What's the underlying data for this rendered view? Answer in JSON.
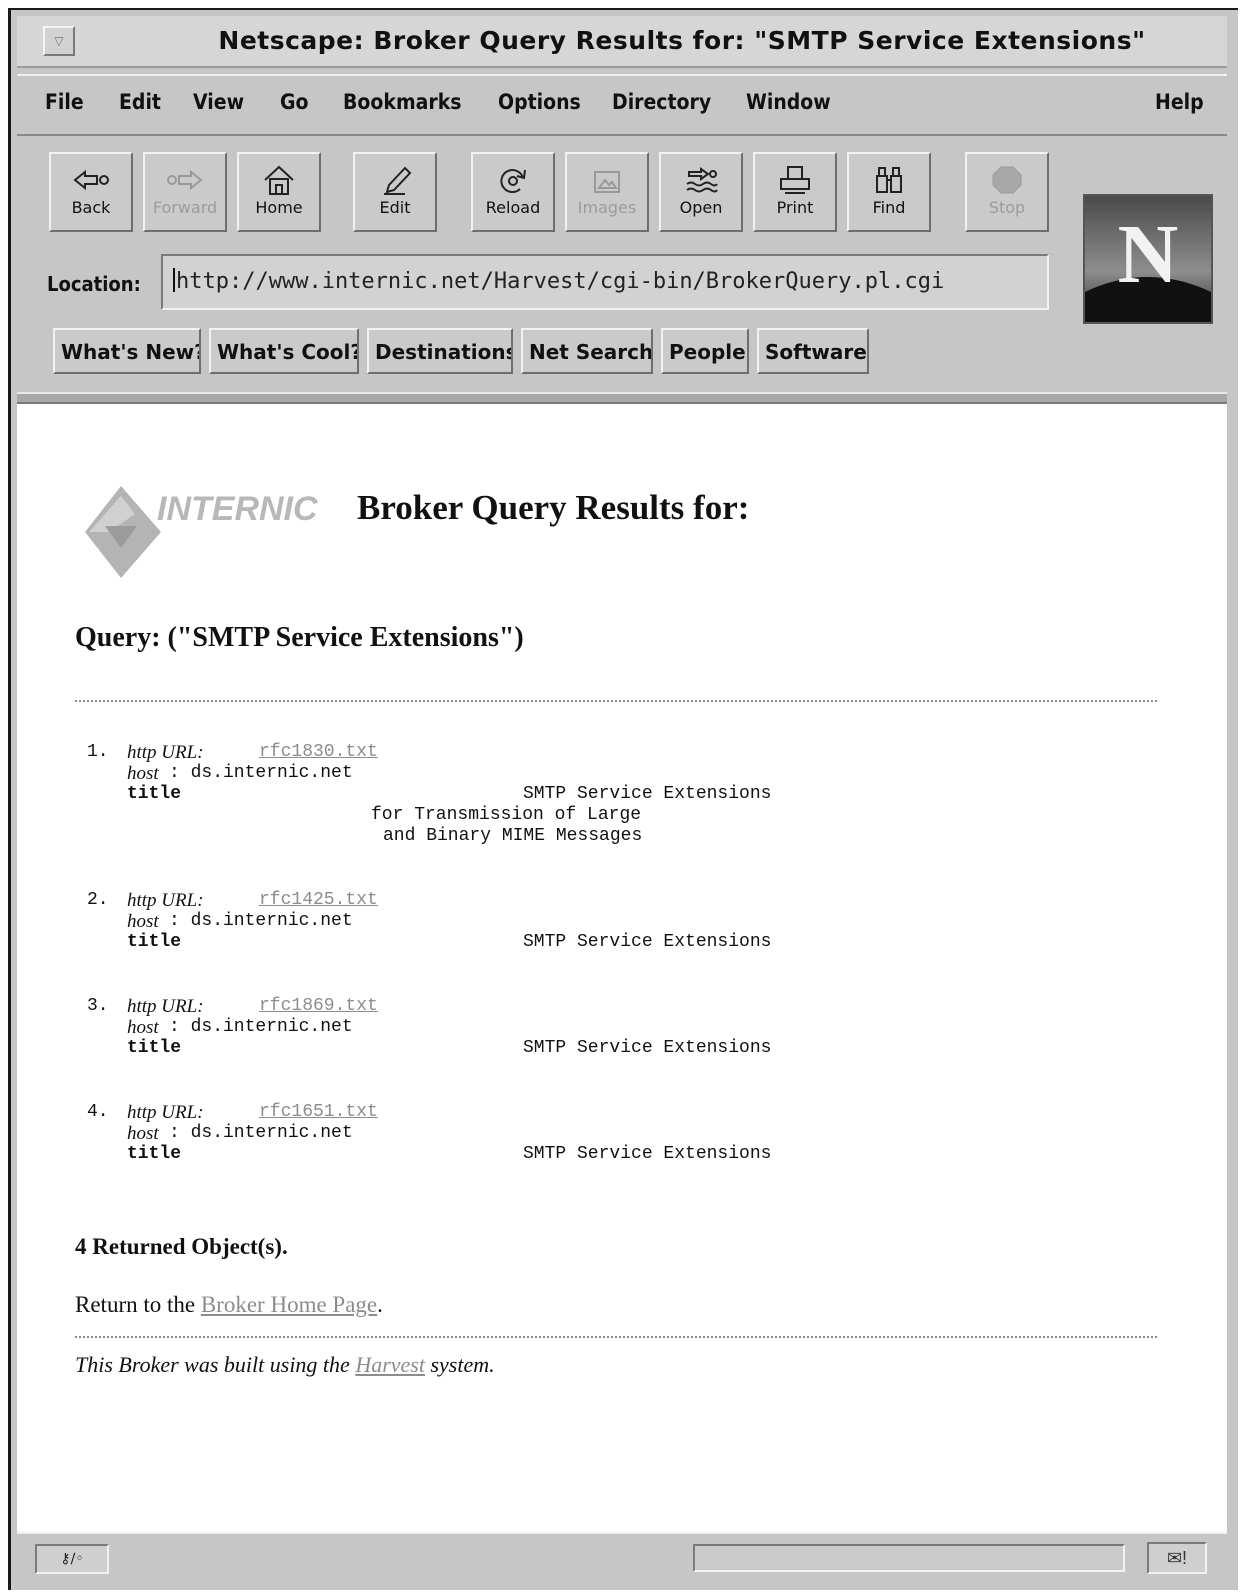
{
  "window": {
    "title": "Netscape: Broker Query Results for: \"SMTP Service Extensions\""
  },
  "menu": [
    {
      "label": "File"
    },
    {
      "label": "Edit"
    },
    {
      "label": "View"
    },
    {
      "label": "Go"
    },
    {
      "label": "Bookmarks"
    },
    {
      "label": "Options"
    },
    {
      "label": "Directory"
    },
    {
      "label": "Window"
    },
    {
      "label": "Help"
    }
  ],
  "toolbar": {
    "buttons": [
      {
        "label": "Back",
        "icon": "back-arrow-icon",
        "enabled": true
      },
      {
        "label": "Forward",
        "icon": "forward-arrow-icon",
        "enabled": false
      },
      {
        "label": "Home",
        "icon": "home-icon",
        "enabled": true
      },
      {
        "label": "Edit",
        "icon": "pencil-icon",
        "enabled": true
      },
      {
        "label": "Reload",
        "icon": "reload-icon",
        "enabled": true
      },
      {
        "label": "Images",
        "icon": "images-icon",
        "enabled": false
      },
      {
        "label": "Open",
        "icon": "open-icon",
        "enabled": true
      },
      {
        "label": "Print",
        "icon": "printer-icon",
        "enabled": true
      },
      {
        "label": "Find",
        "icon": "binoculars-icon",
        "enabled": true
      },
      {
        "label": "Stop",
        "icon": "stop-icon",
        "enabled": false
      }
    ]
  },
  "location": {
    "label": "Location:",
    "url": "http://www.internic.net/Harvest/cgi-bin/BrokerQuery.pl.cgi"
  },
  "directory_buttons": [
    {
      "label": "What's New?"
    },
    {
      "label": "What's Cool?"
    },
    {
      "label": "Destinations"
    },
    {
      "label": "Net Search"
    },
    {
      "label": "People"
    },
    {
      "label": "Software"
    }
  ],
  "page": {
    "logo_text": "INTERNIC",
    "heading": "Broker Query Results for:",
    "query": "Query: (\"SMTP Service Extensions\")",
    "results": [
      {
        "num": "1.",
        "url_label": "http URL:",
        "url": "rfc1830.txt",
        "host_label": "host",
        "host": ": ds.internic.net",
        "title_label": "title",
        "title_lines": [
          "SMTP Service Extensions",
          "for Transmission of Large",
          "and Binary MIME Messages"
        ]
      },
      {
        "num": "2.",
        "url_label": "http URL:",
        "url": "rfc1425.txt",
        "host_label": "host",
        "host": ": ds.internic.net",
        "title_label": "title",
        "title_lines": [
          "SMTP Service Extensions"
        ]
      },
      {
        "num": "3.",
        "url_label": "http URL:",
        "url": "rfc1869.txt",
        "host_label": "host",
        "host": ": ds.internic.net",
        "title_label": "title",
        "title_lines": [
          "SMTP Service Extensions"
        ]
      },
      {
        "num": "4.",
        "url_label": "http URL:",
        "url": "rfc1651.txt",
        "host_label": "host",
        "host": ": ds.internic.net",
        "title_label": "title",
        "title_lines": [
          "SMTP Service Extensions"
        ]
      }
    ],
    "returned": "4 Returned Object(s).",
    "return_prefix": "Return to the ",
    "return_link": "Broker Home Page",
    "return_suffix": ".",
    "footer_prefix": "This Broker was built using the ",
    "footer_link": "Harvest",
    "footer_suffix": " system."
  },
  "status": {
    "security_icon": "broken-key-icon",
    "mail_icon": "mail-icon"
  }
}
